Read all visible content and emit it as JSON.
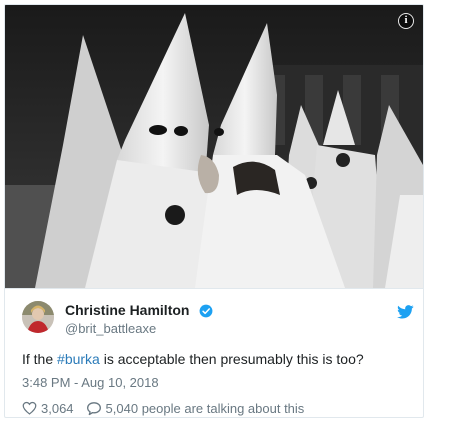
{
  "tweet": {
    "author": {
      "name": "Christine Hamilton",
      "handle": "@brit_battleaxe",
      "verified": true
    },
    "text_before": "If the ",
    "hashtag": "#burka",
    "text_after": " is acceptable then presumably this is too?",
    "timestamp": "3:48 PM - Aug 10, 2018",
    "likes": "3,064",
    "talking": "5,040 people are talking about this"
  },
  "icons": {
    "info": "info-icon",
    "verified": "verified-badge-icon",
    "brand": "twitter-bird-icon",
    "like": "heart-icon",
    "reply": "speech-bubble-icon"
  },
  "colors": {
    "link": "#2b7bb9",
    "brand": "#1da1f2",
    "muted": "#697882",
    "text": "#1c2022"
  }
}
